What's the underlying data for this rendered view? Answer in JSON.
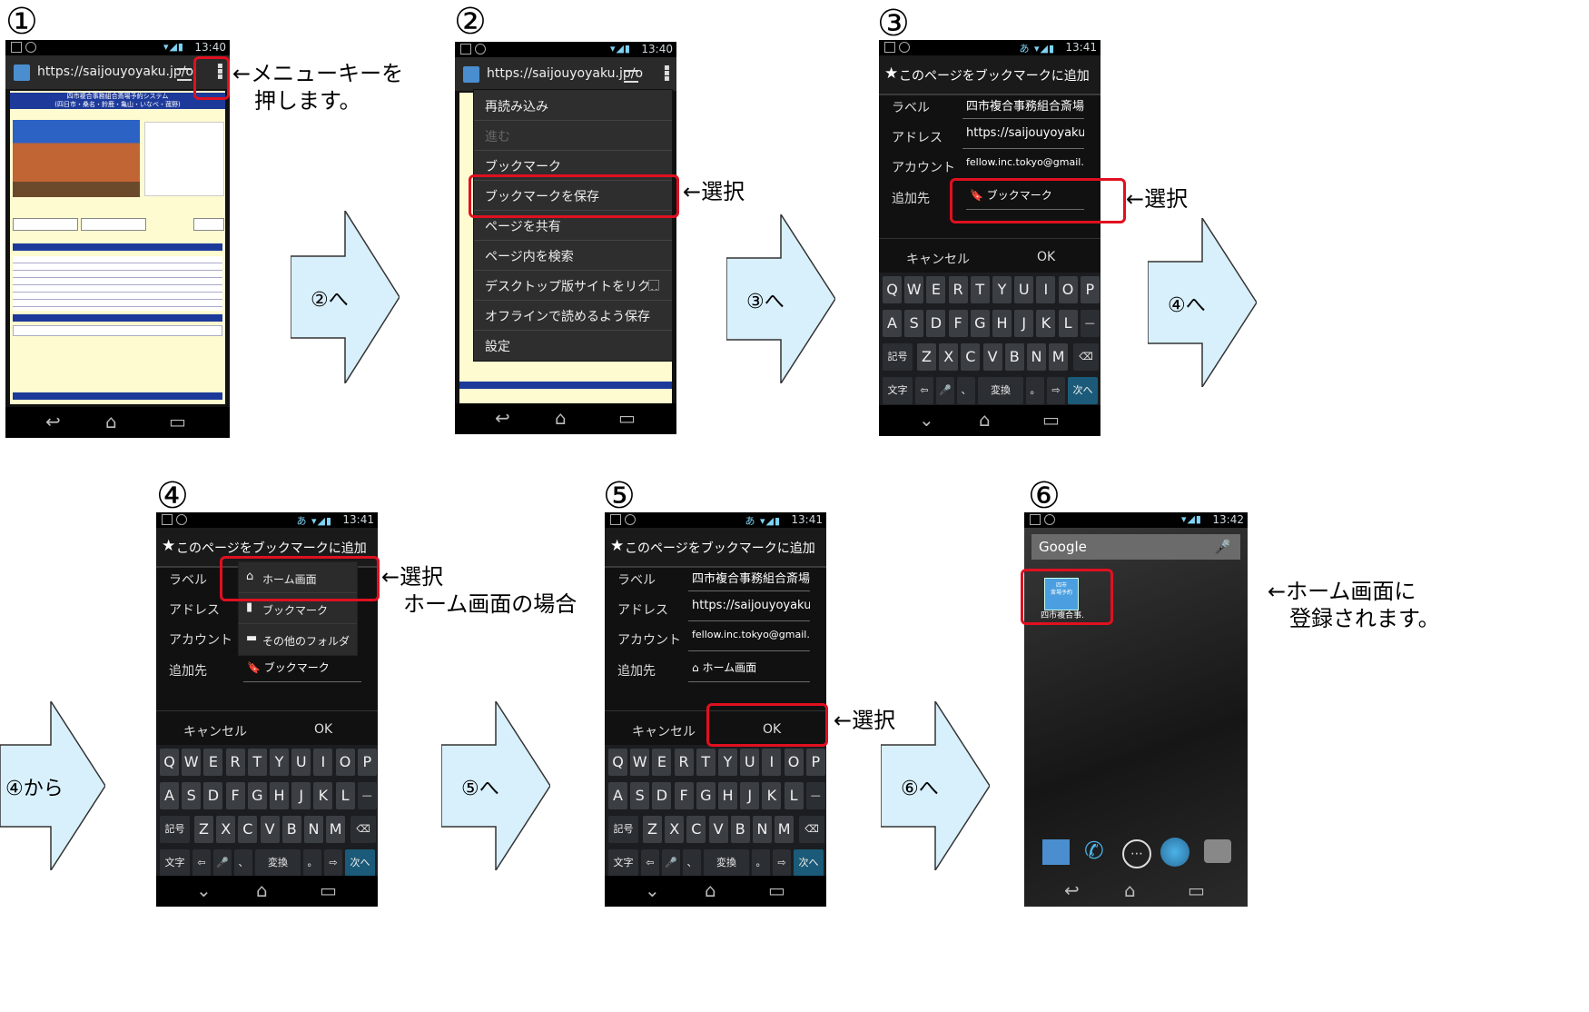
{
  "steps": {
    "s1": {
      "num": "①"
    },
    "s2": {
      "num": "②"
    },
    "s3": {
      "num": "③"
    },
    "s4": {
      "num": "④"
    },
    "s5": {
      "num": "⑤"
    },
    "s6": {
      "num": "⑥"
    }
  },
  "status": {
    "time1": "13:40",
    "time2": "13:40",
    "time3": "13:41",
    "time4": "13:41",
    "time5": "13:41",
    "time6": "13:42",
    "ime": "あ"
  },
  "browser": {
    "url": "https://saijouyoyaku.jp/o"
  },
  "web": {
    "title": "四市複合事務組合斎場予約システム",
    "sub": "(四日市・桑名・鈴鹿・亀山・いなべ・菰野)"
  },
  "menu": {
    "items": [
      "再読み込み",
      "進む",
      "ブックマーク",
      "ブックマークを保存",
      "ページを共有",
      "ページ内を検索",
      "デスクトップ版サイトをリク..",
      "オフラインで読めるよう保存",
      "設定"
    ]
  },
  "dialog": {
    "title": "このページをブックマークに追加",
    "label_label": "ラベル",
    "label_value": "四市複合事務組合斎場:",
    "address_label": "アドレス",
    "address_value": "https://saijouyoyaku.jp.",
    "account_label": "アカウント",
    "account_value": "fellow.inc.tokyo@gmail..",
    "dest_label": "追加先",
    "dest_bookmark": "ブックマーク",
    "dest_home": "ホーム画面",
    "other_folder": "その他のフォルダ",
    "cancel": "キャンセル",
    "ok": "OK"
  },
  "keyboard": {
    "row1": [
      "Q",
      "W",
      "E",
      "R",
      "T",
      "Y",
      "U",
      "I",
      "O",
      "P"
    ],
    "row2": [
      "A",
      "S",
      "D",
      "F",
      "G",
      "H",
      "J",
      "K",
      "L",
      "—"
    ],
    "row3": [
      "Z",
      "X",
      "C",
      "V",
      "B",
      "N",
      "M"
    ],
    "kigou": "記号",
    "moji": "文字",
    "henkan": "変換",
    "comma": "、",
    "period": "。",
    "next": "次へ",
    "backspace": "⌫"
  },
  "home": {
    "search": "Google",
    "shortcut_label": "四市複合事.",
    "shortcut_icon_text": "四市\n斎場予約"
  },
  "annotations": {
    "a1": "←メニューキーを\n　押します。",
    "a2": "←選択",
    "a3": "←選択",
    "a4": "←選択\n　ホーム画面の場合",
    "a5": "←選択",
    "a6": "←ホーム画面に\n　登録されます。"
  },
  "arrows": {
    "to2": "②へ",
    "to3": "③へ",
    "to4": "④へ",
    "from4": "④から",
    "to5": "⑤へ",
    "to6": "⑥へ"
  },
  "colors": {
    "arrow_fill": "#d8f0fc",
    "highlight": "#e01020"
  }
}
